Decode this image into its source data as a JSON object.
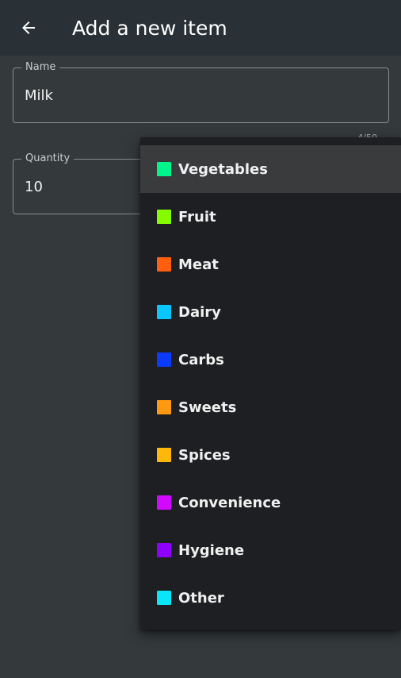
{
  "appbar": {
    "back_icon": "arrow-left-icon",
    "title": "Add a new item"
  },
  "form": {
    "name": {
      "label": "Name",
      "value": "Milk",
      "counter": "4/50"
    },
    "quantity": {
      "label": "Quantity",
      "value": "10"
    }
  },
  "category_menu": {
    "selected_index": 0,
    "items": [
      {
        "label": "Vegetables",
        "color": "#00f58a"
      },
      {
        "label": "Fruit",
        "color": "#86fb00"
      },
      {
        "label": "Meat",
        "color": "#ff5f0f"
      },
      {
        "label": "Dairy",
        "color": "#0ac6ff"
      },
      {
        "label": "Carbs",
        "color": "#0a3bff"
      },
      {
        "label": "Sweets",
        "color": "#ff9912"
      },
      {
        "label": "Spices",
        "color": "#ffb70a"
      },
      {
        "label": "Convenience",
        "color": "#d10aff"
      },
      {
        "label": "Hygiene",
        "color": "#8f00ff"
      },
      {
        "label": "Other",
        "color": "#08e6f7"
      }
    ]
  }
}
